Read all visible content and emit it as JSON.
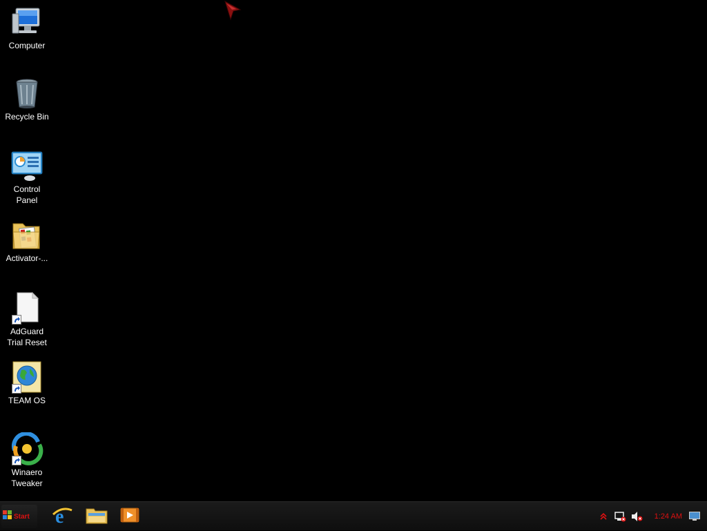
{
  "desktop": {
    "icons": [
      {
        "label": "Computer",
        "icon": "computer-icon"
      },
      {
        "label": "Recycle Bin",
        "icon": "recycle-bin-icon"
      },
      {
        "label": "Control\nPanel",
        "icon": "control-panel-icon"
      },
      {
        "label": "Activator-...",
        "icon": "folder-icon"
      },
      {
        "label": "AdGuard\nTrial Reset",
        "icon": "document-shortcut-icon"
      },
      {
        "label": "TEAM OS",
        "icon": "globe-shortcut-icon"
      },
      {
        "label": "Winaero\nTweaker",
        "icon": "winaero-shortcut-icon"
      }
    ]
  },
  "taskbar": {
    "start_label": "Start",
    "pinned": [
      {
        "name": "internet-explorer",
        "icon": "internet-explorer-icon"
      },
      {
        "name": "file-explorer",
        "icon": "file-explorer-icon"
      },
      {
        "name": "media-player",
        "icon": "media-player-icon"
      }
    ],
    "tray": {
      "clock": "1:24 AM",
      "icons": [
        "show-hidden-icons-arrow",
        "network-icon",
        "volume-muted-icon",
        "show-desktop-icon"
      ]
    }
  },
  "colors": {
    "desktop_bg": "#000000",
    "taskbar_bg": "#141414",
    "accent_red": "#dd1111"
  }
}
